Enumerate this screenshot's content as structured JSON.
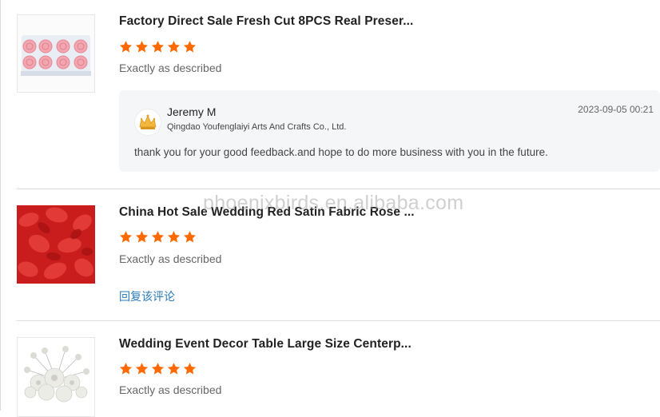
{
  "reviews": [
    {
      "title": "Factory Direct Sale Fresh Cut 8PCS Real Preser...",
      "rating": 5,
      "description": "Exactly as described",
      "image": "pink-preserved-roses-box",
      "reply": {
        "name": "Jeremy M",
        "company": "Qingdao Youfenglaiyi Arts And Crafts Co., Ltd.",
        "date": "2023-09-05 00:21",
        "text": "thank you for your good feedback.and hope to do more business with you in the future.",
        "avatar_icon": "crown-logo-icon"
      }
    },
    {
      "title": "China Hot Sale Wedding Red Satin Fabric Rose ...",
      "rating": 5,
      "description": "Exactly as described",
      "image": "red-rose-petals",
      "reply_link": "回复该评论"
    },
    {
      "title": "Wedding Event Decor Table Large Size Centerp...",
      "rating": 5,
      "description": "Exactly as described",
      "image": "white-flower-centerpiece"
    }
  ],
  "watermark": "phoenixbirds.en.alibaba.com",
  "colors": {
    "star": "#ff6a00",
    "link": "#2b7bb9",
    "reply_bg": "#f5f6f7"
  }
}
